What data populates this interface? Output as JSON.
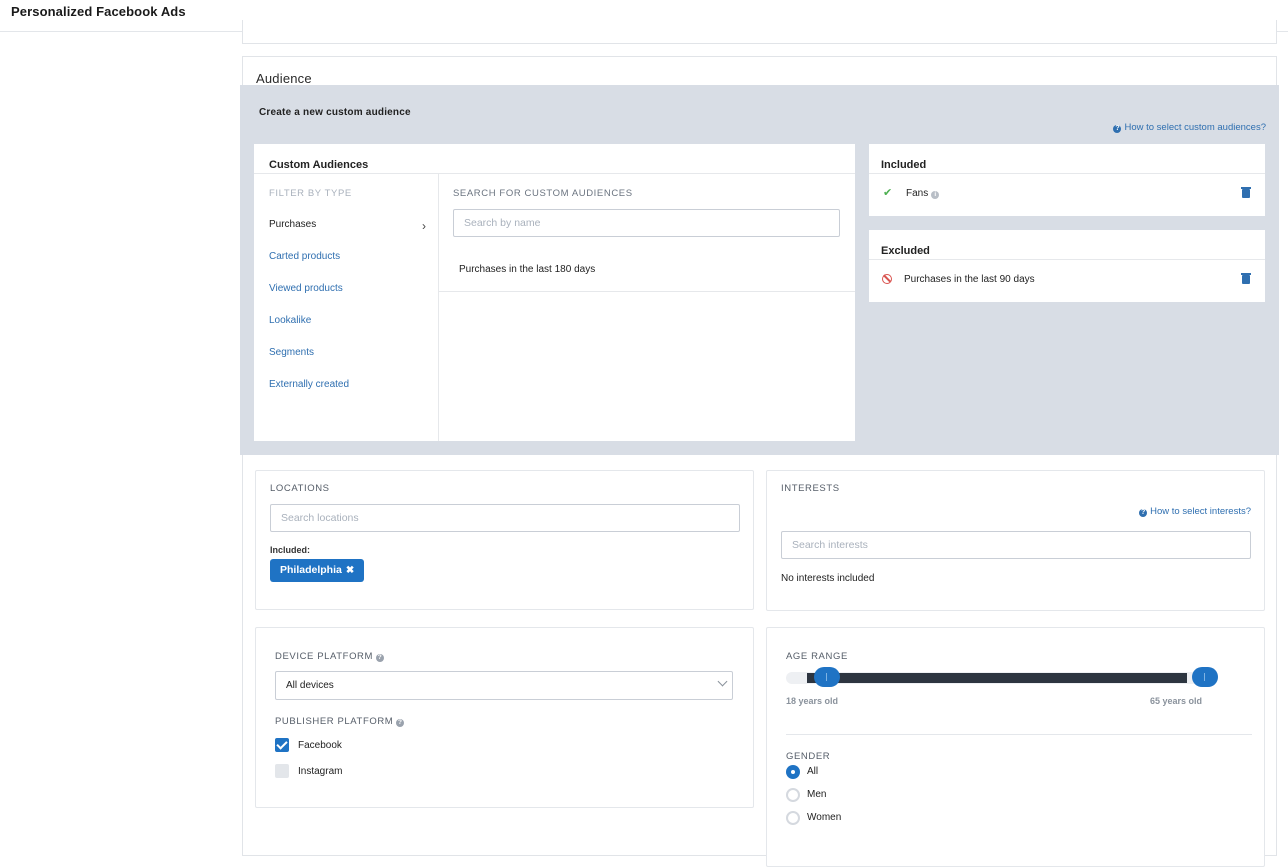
{
  "app": {
    "title": "Personalized Facebook Ads"
  },
  "audience": {
    "title": "Audience",
    "create_label": "Create a new custom audience",
    "help_custom": "How to select custom audiences?",
    "custom_audiences": {
      "title": "Custom Audiences",
      "filter_heading": "FILTER BY TYPE",
      "filters": [
        "Purchases",
        "Carted products",
        "Viewed products",
        "Lookalike",
        "Segments",
        "Externally created"
      ],
      "search_heading": "SEARCH FOR CUSTOM AUDIENCES",
      "search_placeholder": "Search by name",
      "results": [
        "Purchases in the last 180 days"
      ]
    },
    "included": {
      "title": "Included",
      "items": [
        "Fans"
      ]
    },
    "excluded": {
      "title": "Excluded",
      "items": [
        "Purchases in the last 90 days"
      ]
    }
  },
  "locations": {
    "heading": "LOCATIONS",
    "placeholder": "Search locations",
    "included_label": "Included:",
    "tags": [
      "Philadelphia"
    ],
    "tag_remove_glyph": "✖"
  },
  "interests": {
    "heading": "INTERESTS",
    "help": "How to select interests?",
    "placeholder": "Search interests",
    "empty_text": "No interests included"
  },
  "device": {
    "heading": "DEVICE PLATFORM",
    "selected": "All devices",
    "publisher_heading": "PUBLISHER PLATFORM",
    "publishers": [
      {
        "label": "Facebook",
        "checked": true
      },
      {
        "label": "Instagram",
        "checked": false
      }
    ]
  },
  "age": {
    "heading": "AGE RANGE",
    "min_label": "18 years old",
    "max_label": "65 years old",
    "min": 18,
    "max": 65
  },
  "gender": {
    "heading": "GENDER",
    "options": [
      "All",
      "Men",
      "Women"
    ],
    "selected": "All"
  },
  "colors": {
    "accent": "#1f73c4",
    "gray_panel": "#d8dde5",
    "link": "#2f6fb0",
    "check": "#4caf50",
    "ban": "#d9534f"
  }
}
